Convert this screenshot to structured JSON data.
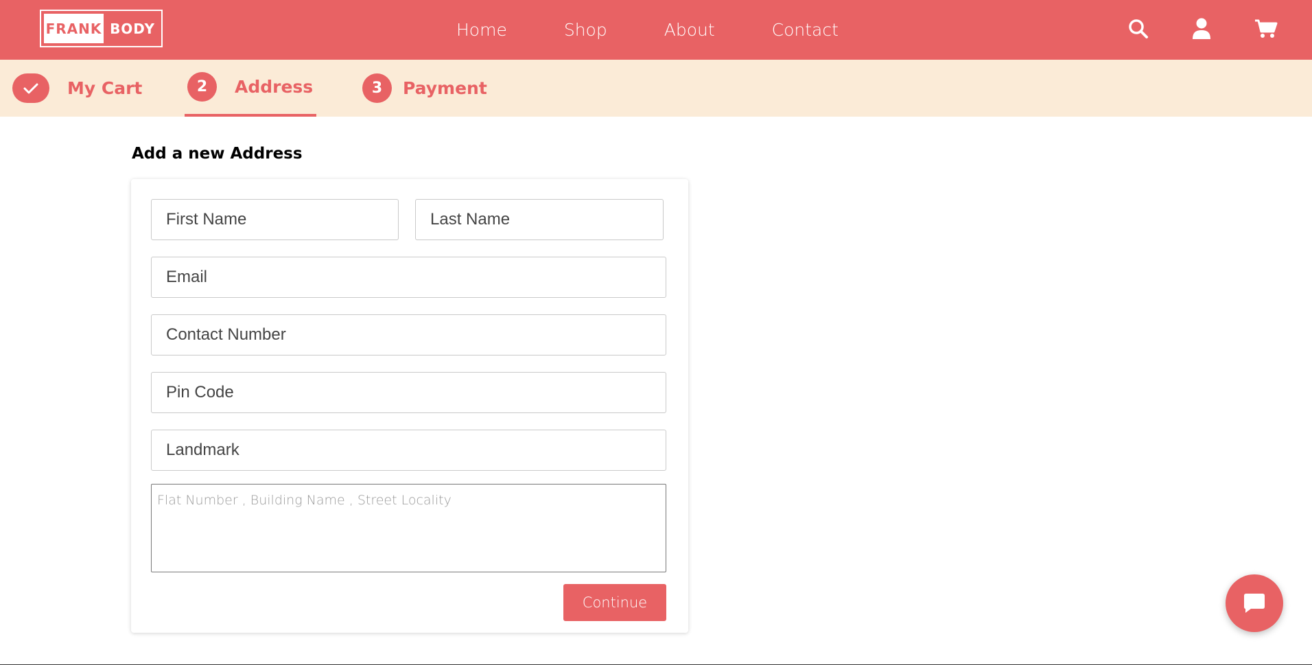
{
  "brand": {
    "logo_left": "FRANK",
    "logo_right": "BODY",
    "accent_color": "#e86264",
    "steps_bg_color": "#fbebd7"
  },
  "nav": {
    "links": [
      "Home",
      "Shop",
      "About",
      "Contact"
    ]
  },
  "header_icons": [
    "search-icon",
    "user-icon",
    "cart-icon"
  ],
  "steps": [
    {
      "marker": "✓",
      "label": "My Cart",
      "state": "completed"
    },
    {
      "marker": "2",
      "label": "Address",
      "state": "active"
    },
    {
      "marker": "3",
      "label": "Payment",
      "state": "pending"
    }
  ],
  "form": {
    "title": "Add a new Address",
    "first_name_placeholder": "First Name",
    "last_name_placeholder": "Last Name",
    "email_placeholder": "Email",
    "contact_placeholder": "Contact Number",
    "pincode_placeholder": "Pin Code",
    "landmark_placeholder": "Landmark",
    "address_placeholder": "Flat Number , Building Name , Street Locality",
    "continue_label": "Continue"
  },
  "chat": {
    "icon": "chat-bubble-icon"
  }
}
